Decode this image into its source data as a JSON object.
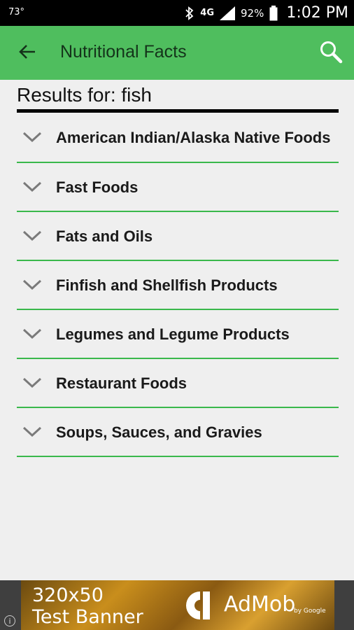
{
  "status_bar": {
    "temperature": "73°",
    "network": "4G",
    "battery_percent": "92%",
    "time": "1:02 PM",
    "icons": [
      "bluetooth-icon",
      "network-4g-icon",
      "signal-icon",
      "battery-icon"
    ]
  },
  "app_bar": {
    "title": "Nutritional Facts",
    "back_icon": "arrow-left-icon",
    "search_icon": "search-icon",
    "color": "#4fbe5e"
  },
  "results": {
    "header": "Results for: fish"
  },
  "categories": [
    {
      "label": "American Indian/Alaska Native Foods"
    },
    {
      "label": "Fast Foods"
    },
    {
      "label": "Fats and Oils"
    },
    {
      "label": "Finfish and Shellfish Products"
    },
    {
      "label": "Legumes and Legume Products"
    },
    {
      "label": "Restaurant Foods"
    },
    {
      "label": "Soups, Sauces, and Gravies"
    }
  ],
  "ad": {
    "size_text": "320x50",
    "test_text": "Test Banner",
    "brand": "AdMob",
    "by": "by Google",
    "info_icon": "info-icon"
  },
  "colors": {
    "accent_green": "#4fbe5e",
    "divider_green": "#39b84b",
    "background": "#efefef"
  }
}
